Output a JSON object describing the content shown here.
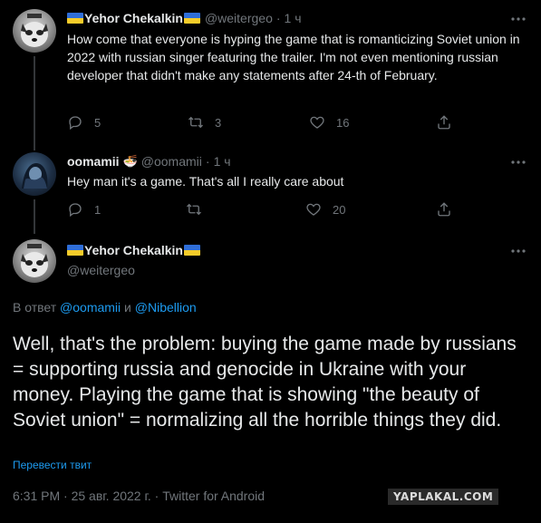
{
  "tweet1": {
    "author_name": "Yehor Chekalkin",
    "handle": "@weitergeo",
    "separator": "·",
    "time": "1 ч",
    "text": "How come that everyone is hyping the game that is romanticizing Soviet union in 2022 with russian singer featuring the trailer. I'm not even mentioning russian developer that didn't make any statements after 24-th of February.",
    "replies": "5",
    "retweets": "3",
    "likes": "16"
  },
  "tweet2": {
    "author_name": "oomamii",
    "emoji": "🍜",
    "handle": "@oomamii",
    "separator": "·",
    "time": "1 ч",
    "text": "Hey man it's a game. That's all I really care about",
    "replies": "1",
    "retweets": "",
    "likes": "20"
  },
  "main_tweet": {
    "author_name": "Yehor Chekalkin",
    "handle": "@weitergeo",
    "reply_prefix": "В ответ",
    "reply_user1": "@oomamii",
    "reply_and": "и",
    "reply_user2": "@Nibellion",
    "text": "Well, that's the problem: buying the game made by russians = supporting russia and genocide in Ukraine with your money. Playing the game that is showing \"the beauty of Soviet union\" = normalizing all the horrible things they did.",
    "translate": "Перевести твит",
    "meta": "6:31 PM · 25 авг. 2022 г. · Twitter for Android"
  },
  "watermark": "YAPLAKAL.COM",
  "icons": {
    "reply": "reply-icon",
    "retweet": "retweet-icon",
    "like": "heart-icon",
    "share": "share-icon",
    "more": "more-icon"
  },
  "colors": {
    "background": "#000000",
    "text": "#e7e9ea",
    "muted": "#71767b",
    "link": "#1d9bf0",
    "flag_blue": "#2f6ed8",
    "flag_yellow": "#f5cc2a"
  }
}
